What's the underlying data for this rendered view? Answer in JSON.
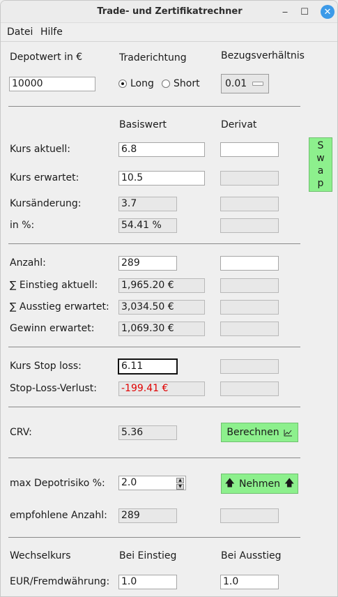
{
  "window": {
    "title": "Trade- und Zertifikatrechner",
    "minimize": "‒",
    "maximize": "☐",
    "close": "✕"
  },
  "menu": {
    "datei": "Datei",
    "hilfe": "Hilfe"
  },
  "header": {
    "depotwert_label": "Depotwert in €",
    "depotwert_value": "10000",
    "traderichtung_label": "Traderichtung",
    "long_label": "Long",
    "short_label": "Short",
    "direction_selected": "Long",
    "bezug_label": "Bezugsverhältnis",
    "bezug_value": "0.01"
  },
  "columns": {
    "basiswert": "Basiswert",
    "derivat": "Derivat"
  },
  "swap": {
    "letters": [
      "S",
      "w",
      "a",
      "p"
    ]
  },
  "kurs": {
    "aktuell_label": "Kurs aktuell:",
    "aktuell_basis": "6.8",
    "aktuell_derivat": "",
    "erwartet_label": "Kurs erwartet:",
    "erwartet_basis": "10.5",
    "erwartet_derivat": "",
    "aenderung_label": "Kursänderung:",
    "aenderung_basis": "3.7",
    "aenderung_derivat": "",
    "prozent_label": "in %:",
    "prozent_basis": "54.41 %",
    "prozent_derivat": ""
  },
  "position": {
    "anzahl_label": "Anzahl:",
    "anzahl_basis": "289",
    "anzahl_derivat": "",
    "einstieg_label": "∑ Einstieg aktuell:",
    "einstieg_basis": "1,965.20 €",
    "ausstieg_label": "∑ Ausstieg erwartet:",
    "ausstieg_basis": "3,034.50 €",
    "gewinn_label": "Gewinn erwartet:",
    "gewinn_basis": "1,069.30 €"
  },
  "stoploss": {
    "kurs_label": "Kurs Stop loss:",
    "kurs_basis": "6.11",
    "verlust_label": "Stop-Loss-Verlust:",
    "verlust_basis": "-199.41 €"
  },
  "crv": {
    "label": "CRV:",
    "value": "5.36",
    "button": "Berechnen",
    "button_icon": "chart-icon"
  },
  "risk": {
    "max_label": "max Depotrisiko %:",
    "max_value": "2.0",
    "nehmen_button": "Nehmen",
    "empfohlen_label": "empfohlene Anzahl:",
    "empfohlen_value": "289"
  },
  "fx": {
    "label": "Wechselkurs",
    "einstieg_label": "Bei Einstieg",
    "ausstieg_label": "Bei Ausstieg",
    "pair_label": "EUR/Fremdwährung:",
    "einstieg_value": "1.0",
    "ausstieg_value": "1.0"
  },
  "colors": {
    "accent_button": "#8df08d",
    "loss_text": "#e00000",
    "close_button": "#3c9ae8"
  }
}
